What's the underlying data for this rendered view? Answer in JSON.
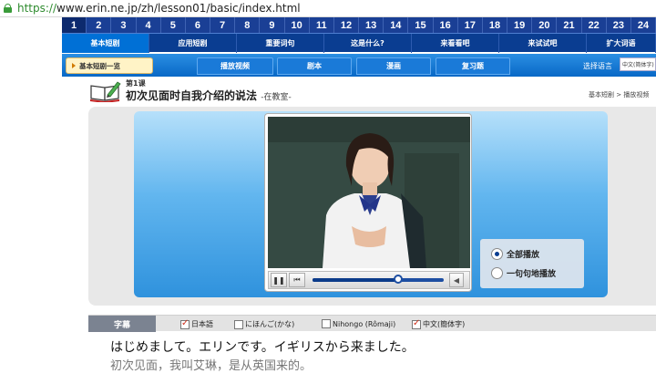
{
  "browser": {
    "url_scheme": "https://",
    "url_rest": "www.erin.ne.jp/zh/lesson01/basic/index.html"
  },
  "lessons": [
    "1",
    "2",
    "3",
    "4",
    "5",
    "6",
    "7",
    "8",
    "9",
    "10",
    "11",
    "12",
    "13",
    "14",
    "15",
    "16",
    "17",
    "18",
    "19",
    "20",
    "21",
    "22",
    "23",
    "24"
  ],
  "lesson_active_index": 0,
  "menu": [
    {
      "label": "基本短剧",
      "active": true
    },
    {
      "label": "应用短剧",
      "active": false
    },
    {
      "label": "重要词句",
      "active": false
    },
    {
      "label": "这是什么?",
      "active": false
    },
    {
      "label": "来看看吧",
      "active": false
    },
    {
      "label": "来试试吧",
      "active": false
    },
    {
      "label": "扩大词语",
      "active": false
    }
  ],
  "subnav": {
    "crumb": "基本短剧一览",
    "tabs": [
      {
        "label": "播放视频",
        "active": true
      },
      {
        "label": "剧本",
        "active": false
      },
      {
        "label": "漫画",
        "active": false
      },
      {
        "label": "复习题",
        "active": false
      }
    ],
    "language_label": "选择语言",
    "language_value": "中文(简体字)"
  },
  "lesson": {
    "number": "第1课",
    "title": "初次见面时自我介绍的说法",
    "scene": "-在教室-"
  },
  "breadcrumb": {
    "first": "基本短剧",
    "separator": ">",
    "second": "播放视频"
  },
  "player": {
    "pause_icon": "pause-icon",
    "prev_icon": "skip-back-icon",
    "progress": 0.65,
    "volume_icon": "speaker-icon"
  },
  "play_mode": {
    "options": [
      {
        "label": "全部播放",
        "selected": true
      },
      {
        "label": "一句句地播放",
        "selected": false
      }
    ]
  },
  "subtitles": {
    "tab_label": "字幕",
    "options": [
      {
        "label": "日本語",
        "checked": true
      },
      {
        "label": "にほんご(かな)",
        "checked": false
      },
      {
        "label": "Nihongo (Rômaji)",
        "checked": false
      },
      {
        "label": "中文(簡体字)",
        "checked": true
      }
    ],
    "line_japanese": "はじめまして。エリンです。イギリスから来ました。",
    "line_chinese": "初次见面，我叫艾琳，是从英国来的。"
  },
  "colors": {
    "lesson_bar": "#1a3f95",
    "menu_bar": "#0a3d91",
    "subnav": "#0868c6",
    "video_bg": "#62b6ef"
  }
}
